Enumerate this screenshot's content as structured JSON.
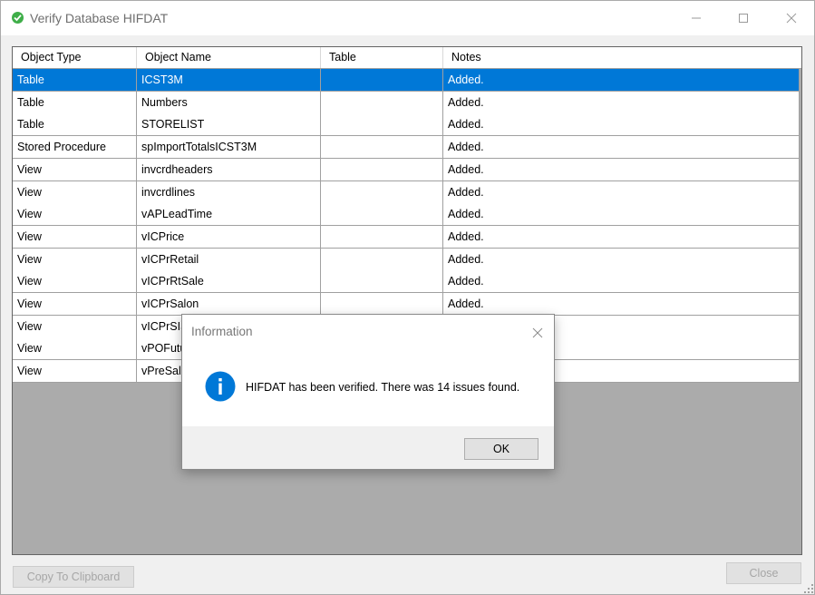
{
  "window": {
    "title": "Verify Database HIFDAT"
  },
  "grid": {
    "columns": [
      "Object Type",
      "Object Name",
      "Table",
      "Notes"
    ],
    "rows": [
      {
        "type": "Table",
        "name": "ICST3M",
        "table": "",
        "notes": "Added.",
        "selected": true
      },
      {
        "type": "Table",
        "name": "Numbers",
        "table": "",
        "notes": "Added."
      },
      {
        "type": "Table",
        "name": "STORELIST",
        "table": "",
        "notes": "Added."
      },
      {
        "type": "Stored Procedure",
        "name": "spImportTotalsICST3M",
        "table": "",
        "notes": "Added."
      },
      {
        "type": "View",
        "name": "invcrdheaders",
        "table": "",
        "notes": "Added."
      },
      {
        "type": "View",
        "name": "invcrdlines",
        "table": "",
        "notes": "Added."
      },
      {
        "type": "View",
        "name": "vAPLeadTime",
        "table": "",
        "notes": "Added."
      },
      {
        "type": "View",
        "name": "vICPrice",
        "table": "",
        "notes": "Added."
      },
      {
        "type": "View",
        "name": "vICPrRetail",
        "table": "",
        "notes": "Added."
      },
      {
        "type": "View",
        "name": "vICPrRtSale",
        "table": "",
        "notes": "Added."
      },
      {
        "type": "View",
        "name": "vICPrSalon",
        "table": "",
        "notes": "Added."
      },
      {
        "type": "View",
        "name": "vICPrSIS",
        "table": "",
        "notes": ""
      },
      {
        "type": "View",
        "name": "vPOFutu",
        "table": "",
        "notes": ""
      },
      {
        "type": "View",
        "name": "vPreSale",
        "table": "",
        "notes": ""
      }
    ]
  },
  "buttons": {
    "copy_label": "Copy To Clipboard",
    "close_label": "Close"
  },
  "dialog": {
    "title": "Information",
    "message": "HIFDAT has been verified. There was 14 issues found.",
    "ok_label": "OK"
  },
  "colors": {
    "selection": "#0078d7",
    "info_icon": "#0078d7"
  }
}
